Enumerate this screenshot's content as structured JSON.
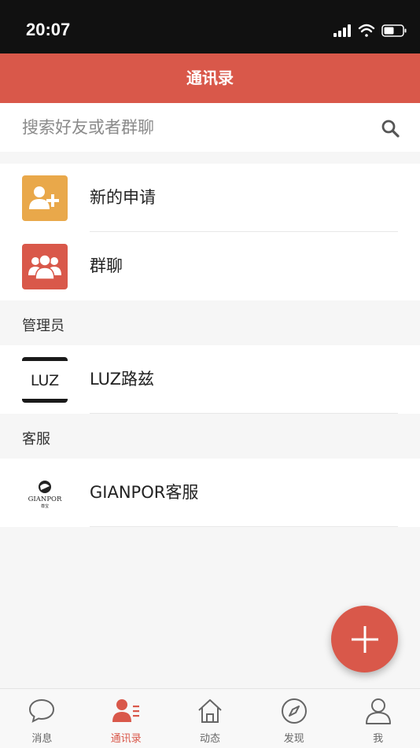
{
  "status_bar": {
    "time": "20:07"
  },
  "header": {
    "title": "通讯录"
  },
  "search": {
    "placeholder": "搜索好友或者群聊",
    "value": ""
  },
  "top_items": [
    {
      "label": "新的申请",
      "icon": "add-user-icon",
      "color": "#e9a84a"
    },
    {
      "label": "群聊",
      "icon": "group-icon",
      "color": "#d9584a"
    }
  ],
  "sections": [
    {
      "title": "管理员",
      "items": [
        {
          "label": "LUZ路兹",
          "avatar_text": "LUZ"
        }
      ]
    },
    {
      "title": "客服",
      "items": [
        {
          "label": "GIANPOR客服",
          "avatar_text": "GIANPOR",
          "avatar_subtext": "尊宝"
        }
      ]
    }
  ],
  "tabs": [
    {
      "label": "消息",
      "icon": "chat-bubble-icon",
      "active": false
    },
    {
      "label": "通讯录",
      "icon": "contacts-icon",
      "active": true
    },
    {
      "label": "动态",
      "icon": "home-icon",
      "active": false
    },
    {
      "label": "发现",
      "icon": "compass-icon",
      "active": false
    },
    {
      "label": "我",
      "icon": "profile-icon",
      "active": false
    }
  ],
  "colors": {
    "accent": "#d9584a",
    "new_request": "#e9a84a",
    "background": "#f6f6f6"
  }
}
